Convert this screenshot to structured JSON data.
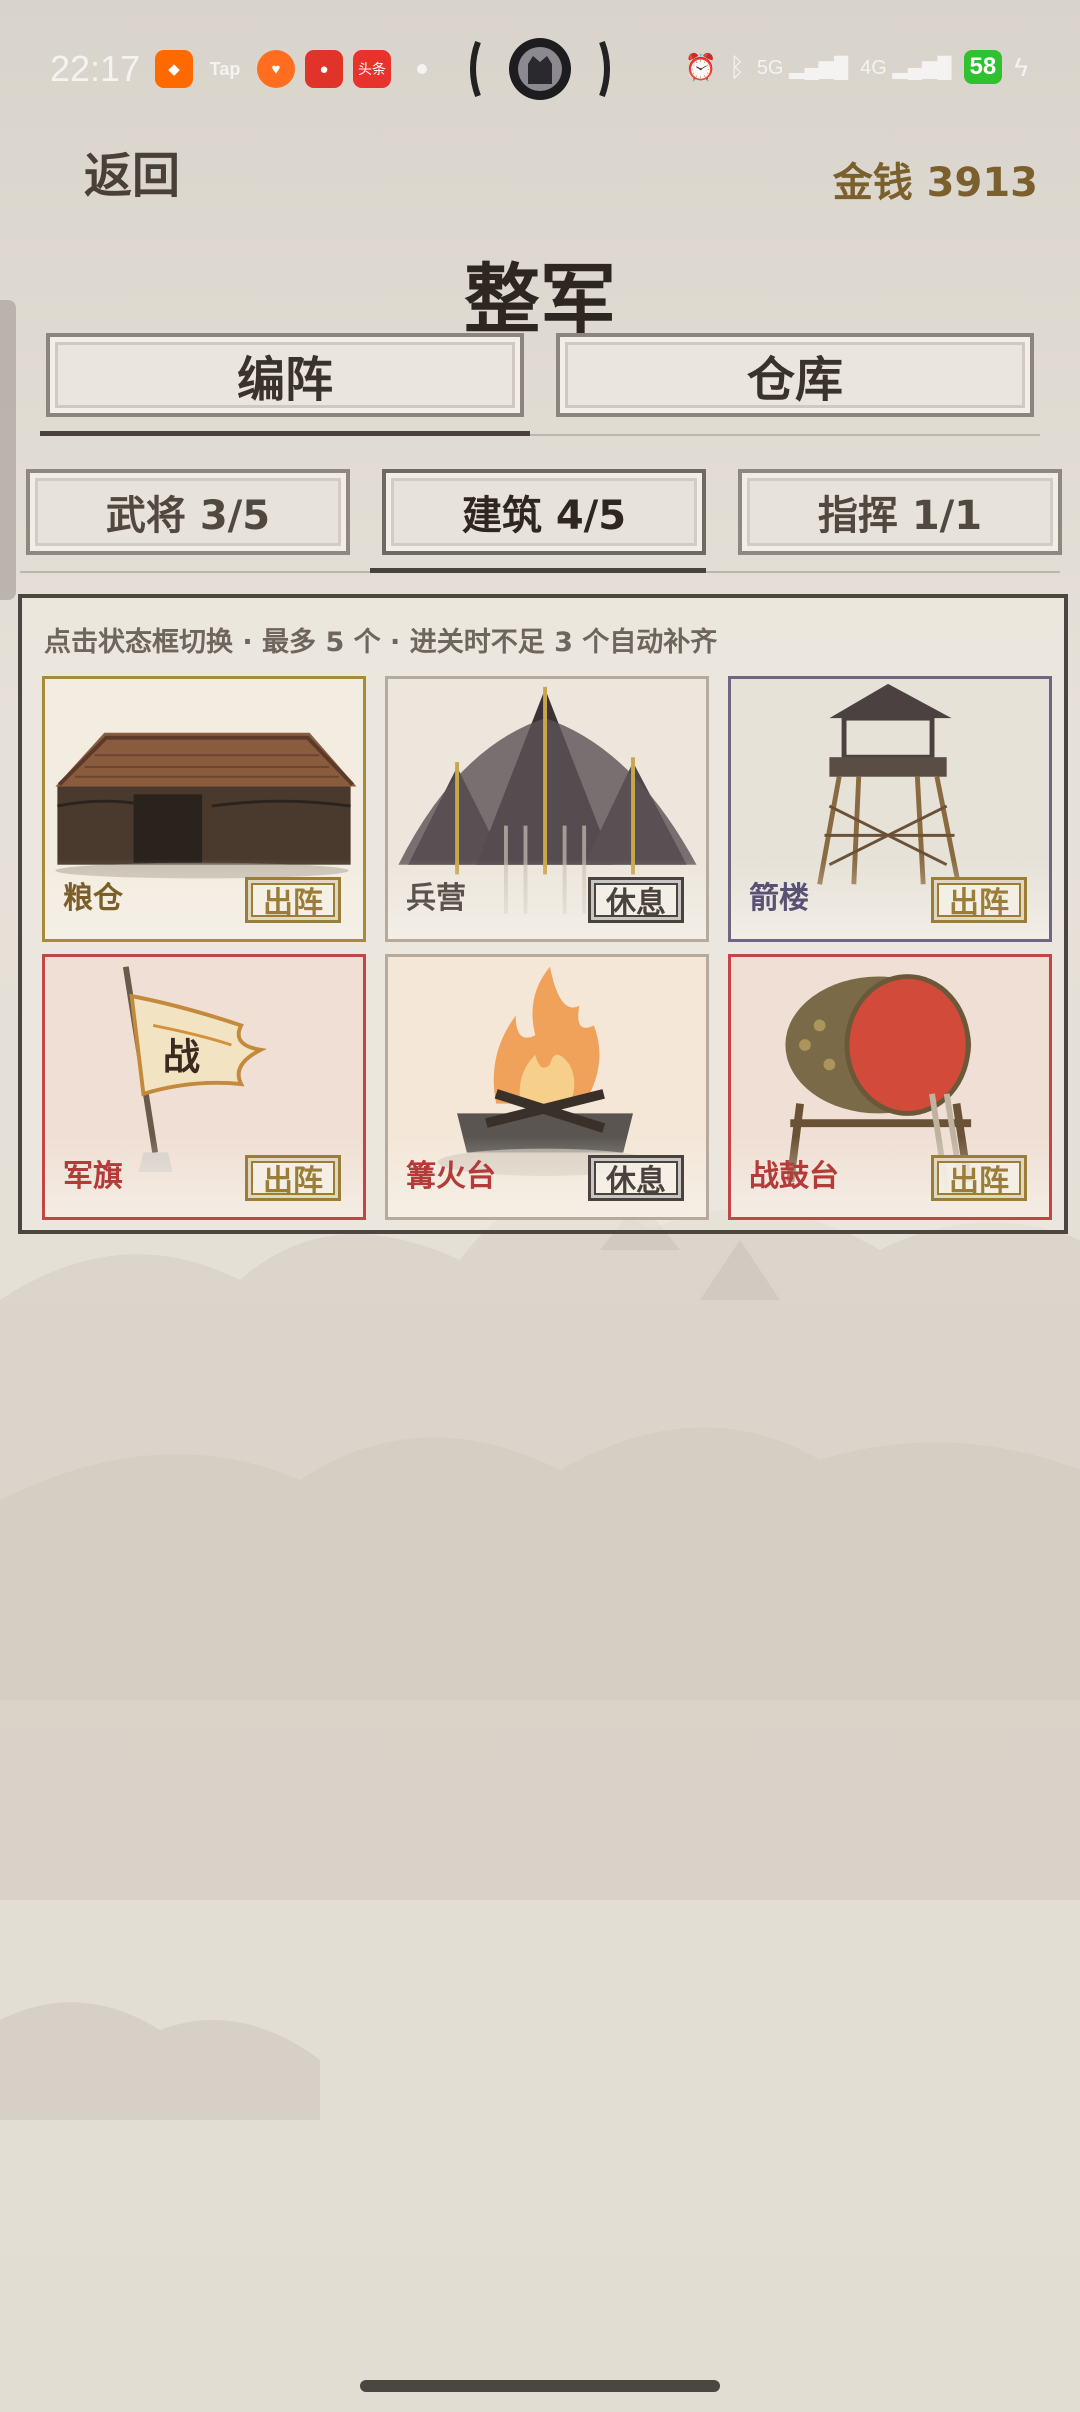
{
  "status_bar": {
    "time": "22:17",
    "apps": [
      {
        "name": "taobao-icon",
        "label": "",
        "color": "#ff6a00"
      },
      {
        "name": "taptap-icon",
        "label": "Tap",
        "color": "transparent"
      },
      {
        "name": "heart-app-icon",
        "label": "",
        "color": "#ff6d1f"
      },
      {
        "name": "red-app-icon",
        "label": "",
        "color": "#e0342a"
      },
      {
        "name": "toutiao-icon",
        "label": "头条",
        "color": "#e8332d"
      }
    ],
    "network": "5G",
    "network2": "4G",
    "battery": "58"
  },
  "header": {
    "back_label": "返回",
    "money_label": "金钱 3913",
    "title": "整军"
  },
  "main_tabs": [
    {
      "label": "编阵",
      "active": true
    },
    {
      "label": "仓库",
      "active": false
    }
  ],
  "sub_tabs": [
    {
      "label": "武将 3/5",
      "active": false
    },
    {
      "label": "建筑 4/5",
      "active": true
    },
    {
      "label": "指挥 1/1",
      "active": false
    }
  ],
  "panel": {
    "hint": "点击状态框切换 · 最多 5 个 · 进关时不足 3 个自动补齐",
    "cards": [
      {
        "name": "粮仓",
        "status": "出阵",
        "theme": "gold"
      },
      {
        "name": "兵营",
        "status": "休息",
        "theme": "grey"
      },
      {
        "name": "箭楼",
        "status": "出阵",
        "theme": "purple"
      },
      {
        "name": "军旗",
        "status": "出阵",
        "theme": "red",
        "flag_char": "战"
      },
      {
        "name": "篝火台",
        "status": "休息",
        "theme": "grey"
      },
      {
        "name": "战鼓台",
        "status": "出阵",
        "theme": "red"
      }
    ]
  },
  "colors": {
    "gold": "#a88a3c",
    "grey": "#b6aa9c",
    "purple": "#6e6682",
    "red": "#c44545"
  }
}
